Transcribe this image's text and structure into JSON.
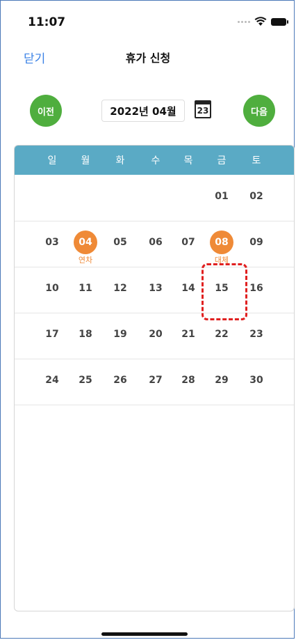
{
  "status": {
    "time": "11:07"
  },
  "nav": {
    "close_label": "닫기",
    "title": "휴가 신청"
  },
  "month": {
    "prev_label": "이전",
    "current": "2022년 04월",
    "next_label": "다음",
    "calendar_icon_day": "23"
  },
  "weekdays": [
    "일",
    "월",
    "화",
    "수",
    "목",
    "금",
    "토"
  ],
  "weeks": [
    [
      {
        "d": ""
      },
      {
        "d": ""
      },
      {
        "d": ""
      },
      {
        "d": ""
      },
      {
        "d": ""
      },
      {
        "d": "01"
      },
      {
        "d": "02"
      }
    ],
    [
      {
        "d": "03"
      },
      {
        "d": "04",
        "marked": true,
        "note": "연차"
      },
      {
        "d": "05"
      },
      {
        "d": "06"
      },
      {
        "d": "07"
      },
      {
        "d": "08",
        "marked": true,
        "note": "대체"
      },
      {
        "d": "09"
      }
    ],
    [
      {
        "d": "10"
      },
      {
        "d": "11"
      },
      {
        "d": "12"
      },
      {
        "d": "13"
      },
      {
        "d": "14"
      },
      {
        "d": "15"
      },
      {
        "d": "16"
      }
    ],
    [
      {
        "d": "17"
      },
      {
        "d": "18"
      },
      {
        "d": "19"
      },
      {
        "d": "20"
      },
      {
        "d": "21"
      },
      {
        "d": "22"
      },
      {
        "d": "23"
      }
    ],
    [
      {
        "d": "24"
      },
      {
        "d": "25"
      },
      {
        "d": "26"
      },
      {
        "d": "27"
      },
      {
        "d": "28"
      },
      {
        "d": "29"
      },
      {
        "d": "30"
      }
    ]
  ],
  "colors": {
    "accent_green": "#4fae3e",
    "header_blue": "#5aaac5",
    "marked_orange": "#ef8a37",
    "link_blue": "#3b82e6",
    "highlight_red": "#e02020"
  }
}
